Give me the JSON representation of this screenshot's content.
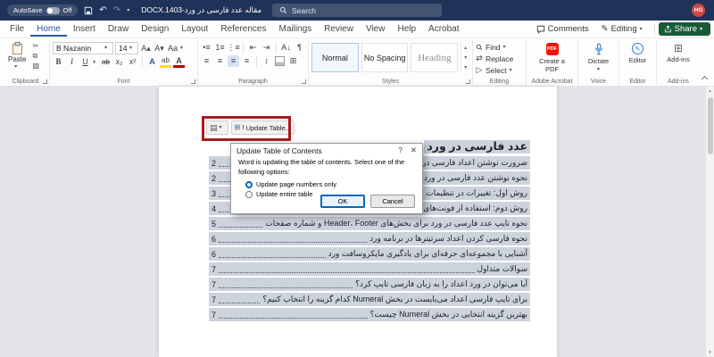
{
  "colors": {
    "titlebar-bg": "#1f3358",
    "accent-blue": "#2b579a",
    "share-green": "#185c37",
    "avatar-bg": "#cf4843",
    "annotation-red": "#a61c1c",
    "selection-highlight": "#ccd3dd",
    "radio-blue": "#0067c0"
  },
  "icons": {
    "caret-down": "▾",
    "undo": "↶",
    "redo": "↷",
    "scissors": "✂",
    "copy": "⧉",
    "format-painter": "▧",
    "bold": "B",
    "italic": "I",
    "underline": "U",
    "strikethrough": "ab",
    "subscript": "x₂",
    "superscript": "x²",
    "grow-font": "A▴",
    "shrink-font": "A▾",
    "change-case": "Aa",
    "text-effects": "A",
    "highlight": "ab",
    "font-color": "A",
    "bullets": "•≡",
    "numbering": "1≡",
    "multilevel": "⋮≡",
    "outdent": "⇤",
    "indent": "⇥",
    "sort": "A↓",
    "pilcrow": "¶",
    "align": "≡",
    "line-spacing": "↕",
    "borders": "⊞",
    "replace": "⇄",
    "select": "▷",
    "toc-page": "▤",
    "update-table": "⊞",
    "alert": "!",
    "help": "?",
    "close": "✕",
    "pencil": "✎",
    "addins": "⊞",
    "up": "▴",
    "down": "▾"
  },
  "titlebar": {
    "autosave_label": "AutoSave",
    "autosave_state": "Off",
    "document_title": "مقاله عدد فارسی در ورد-1403.DOCX",
    "search_placeholder": "Search",
    "avatar_initials": "HG"
  },
  "menubar": {
    "tabs": [
      "File",
      "Home",
      "Insert",
      "Draw",
      "Design",
      "Layout",
      "References",
      "Mailings",
      "Review",
      "View",
      "Help",
      "Acrobat"
    ],
    "active_tab": "Home",
    "comments_label": "Comments",
    "editing_label": "Editing",
    "share_label": "Share"
  },
  "ribbon": {
    "paste_label": "Paste",
    "font_name": "B Nazanin",
    "font_size": "14",
    "style_gallery": [
      "Normal",
      "No Spacing",
      "Heading"
    ],
    "find_label": "Find",
    "replace_label": "Replace",
    "select_label": "Select",
    "create_pdf_label": "Create a PDF",
    "dictate_label": "Dictate",
    "editor_label": "Editor",
    "addins_label": "Add-ins",
    "group_labels": {
      "clipboard": "Clipboard",
      "font": "Font",
      "paragraph": "Paragraph",
      "styles": "Styles",
      "editing": "Editing",
      "adobe": "Adobe Acrobat",
      "voice": "Voice",
      "editor": "Editor",
      "addins": "Add-ins"
    }
  },
  "document": {
    "update_table_label": "Update Table...",
    "heading": "عدد فارسی در ورد",
    "toc_entries": [
      {
        "text": "ضرورت نوشتن اعداد فارسی در ورد",
        "page": "2"
      },
      {
        "text": "نحوه نوشتن عدد فارسی در ورد",
        "page": "2"
      },
      {
        "text": "روش اول: تغییرات در تنظیمات ورد",
        "page": "3"
      },
      {
        "text": "روش دوم: استفاده از فونت‌های فارسی",
        "page": "4"
      },
      {
        "text": "نحوه تایپ عدد فارسی در ورد برای بخش‌های Header، Footer و شماره صفحات",
        "page": "5"
      },
      {
        "text": "نحوه فارسی کردن اعداد سرتیترها در برنامه ورد",
        "page": "6"
      },
      {
        "text": "آشنایی با مجموعه‌ای حرفه‌ای برای یادگیری مایکروسافت ورد",
        "page": "6"
      },
      {
        "text": "سوالات متداول",
        "page": "7"
      },
      {
        "text": "آیا می‌توان در ورد اعداد را به زبان فارسی تایپ کرد؟",
        "page": "7"
      },
      {
        "text": "برای تایپ فارسی اعداد می‌بایست در بخش Numeral کدام گزینه را انتخاب کنیم؟",
        "page": "7"
      },
      {
        "text": "بهترین گزینه انتخابی در بخش Numeral چیست؟",
        "page": "7"
      }
    ]
  },
  "dialog": {
    "title": "Update Table of Contents",
    "message": "Word is updating the table of contents.  Select one of the following options:",
    "option_page_numbers": "Update page numbers only",
    "option_entire_table": "Update entire table",
    "selected_option": "Update page numbers only",
    "ok_label": "OK",
    "cancel_label": "Cancel"
  }
}
